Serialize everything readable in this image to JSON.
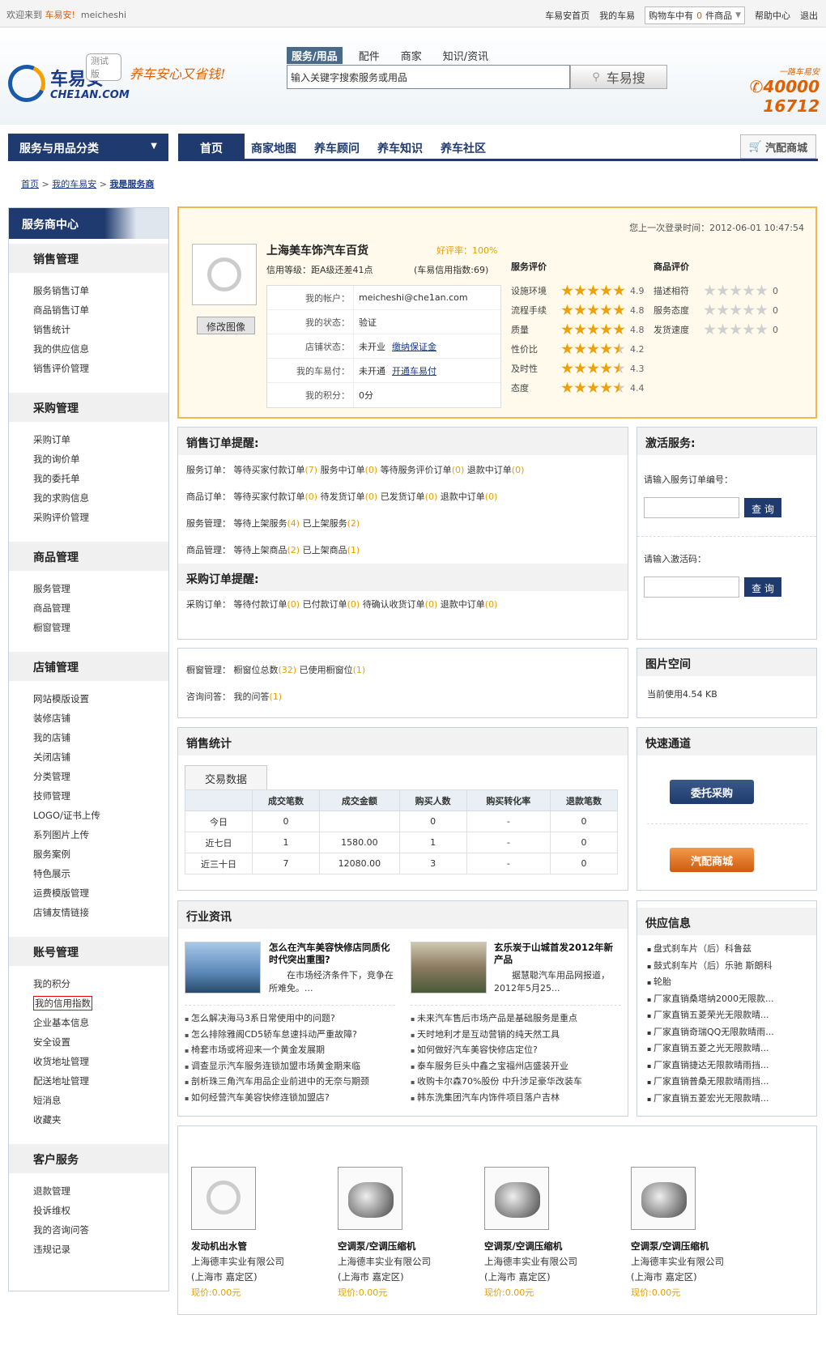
{
  "topbar": {
    "welcome": "欢迎来到",
    "site": "车易安!",
    "user": "meicheshi",
    "links": [
      "车易安首页",
      "我的车易"
    ],
    "cart_prefix": "购物车中有",
    "cart_count": "0",
    "cart_suffix": "件商品",
    "help": "帮助中心",
    "logout": "退出"
  },
  "header": {
    "logo_cn": "车易安",
    "logo_en": "CHE1AN.COM",
    "test_tag": "测试版",
    "slogan": "养车安心又省钱!",
    "search_tabs": [
      "服务/用品",
      "配件",
      "商家",
      "知识/资讯"
    ],
    "search_placeholder": "输入关键字搜索服务或用品",
    "search_button": "车易搜",
    "hotline_tag": "一路车易安",
    "hotline": "40000 16712"
  },
  "nav": {
    "category": "服务与用品分类",
    "items": [
      "首页",
      "商家地图",
      "养车顾问",
      "养车知识",
      "养车社区"
    ],
    "mall": "汽配商城"
  },
  "breadcrumb": [
    "首页",
    "我的车易安",
    "我是服务商"
  ],
  "sidebar": {
    "title": "服务商中心",
    "sections": [
      {
        "title": "销售管理",
        "items": [
          "服务销售订单",
          "商品销售订单",
          "销售统计",
          "我的供应信息",
          "销售评价管理"
        ]
      },
      {
        "title": "采购管理",
        "items": [
          "采购订单",
          "我的询价单",
          "我的委托单",
          "我的求购信息",
          "采购评价管理"
        ]
      },
      {
        "title": "商品管理",
        "items": [
          "服务管理",
          "商品管理",
          "橱窗管理"
        ]
      },
      {
        "title": "店铺管理",
        "items": [
          "网站模版设置",
          "装修店铺",
          "我的店铺",
          "关闭店铺",
          "分类管理",
          "技师管理",
          "LOGO/证书上传",
          "系列图片上传",
          "服务案例",
          "特色展示",
          "运费模版管理",
          "店铺友情链接"
        ]
      },
      {
        "title": "账号管理",
        "items": [
          "我的积分",
          "我的信用指数",
          "企业基本信息",
          "安全设置",
          "收货地址管理",
          "配送地址管理",
          "短消息",
          "收藏夹"
        ]
      },
      {
        "title": "客户服务",
        "items": [
          "退款管理",
          "投诉维权",
          "我的咨询问答",
          "违规记录"
        ]
      }
    ]
  },
  "profile": {
    "last_login": "您上一次登录时间：2012-06-01 10:47:54",
    "shop_name": "上海美车饰汽车百货",
    "good_rate": "好评率：100%",
    "credit_level": "信用等级：距A级还差41点",
    "credit_index": "(车易信用指数:69)",
    "change_pic": "修改图像",
    "info": [
      {
        "k": "我的帐户：",
        "v": "meicheshi@che1an.com",
        "link": ""
      },
      {
        "k": "我的状态：",
        "v": "验证",
        "link": ""
      },
      {
        "k": "店铺状态：",
        "v": "未开业",
        "link": "缴纳保证金"
      },
      {
        "k": "我的车易付：",
        "v": "未开通",
        "link": "开通车易付"
      },
      {
        "k": "我的积分：",
        "v": "0分",
        "link": ""
      }
    ],
    "service_title": "服务评价",
    "service_ratings": [
      {
        "k": "设施环境",
        "v": 4.9
      },
      {
        "k": "流程手续",
        "v": 4.8
      },
      {
        "k": "质量",
        "v": 4.8
      },
      {
        "k": "性价比",
        "v": 4.2
      },
      {
        "k": "及时性",
        "v": 4.3
      },
      {
        "k": "态度",
        "v": 4.4
      }
    ],
    "goods_title": "商品评价",
    "goods_ratings": [
      {
        "k": "描述相符",
        "v": 0
      },
      {
        "k": "服务态度",
        "v": 0
      },
      {
        "k": "发货速度",
        "v": 0
      }
    ]
  },
  "reminders": {
    "sales_title": "销售订单提醒:",
    "sales_lines": [
      [
        [
          "服务订单：  等待买家付款订单",
          "7"
        ],
        [
          "服务中订单",
          "0"
        ],
        [
          "等待服务评价订单",
          "0"
        ],
        [
          "退款中订单",
          "0"
        ]
      ],
      [
        [
          "商品订单：  等待买家付款订单",
          "0"
        ],
        [
          "待发货订单",
          "0"
        ],
        [
          "已发货订单",
          "0"
        ],
        [
          "退款中订单",
          "0"
        ]
      ],
      [
        [
          "服务管理：  等待上架服务",
          "4"
        ],
        [
          "已上架服务",
          "2"
        ]
      ],
      [
        [
          "商品管理：  等待上架商品",
          "2"
        ],
        [
          "已上架商品",
          "1"
        ]
      ]
    ],
    "purchase_title": "采购订单提醒:",
    "purchase_lines": [
      [
        [
          "采购订单：  等待付款订单",
          "0"
        ],
        [
          "已付款订单",
          "0"
        ],
        [
          "待确认收货订单",
          "0"
        ],
        [
          "退款中订单",
          "0"
        ]
      ]
    ]
  },
  "activate": {
    "title": "激活服务:",
    "label1": "请输入服务订单编号：",
    "label2": "请输入激活码：",
    "button": "查 询"
  },
  "window": {
    "lines": [
      [
        [
          "橱窗管理：  橱窗位总数",
          "32"
        ],
        [
          "已使用橱窗位",
          "1"
        ]
      ],
      [
        [
          "咨询问答：  我的问答",
          "1"
        ]
      ]
    ]
  },
  "photo": {
    "title": "图片空间",
    "usage": "当前使用4.54 KB"
  },
  "sales_stats": {
    "title": "销售统计",
    "tab": "交易数据",
    "headers": [
      "",
      "成交笔数",
      "成交金额",
      "购买人数",
      "购买转化率",
      "退款笔数"
    ],
    "rows": [
      [
        "今日",
        "0",
        "",
        "0",
        "-",
        "0"
      ],
      [
        "近七日",
        "1",
        "1580.00",
        "1",
        "-",
        "0"
      ],
      [
        "近三十日",
        "7",
        "12080.00",
        "3",
        "-",
        "0"
      ]
    ]
  },
  "quick": {
    "title": "快速通道",
    "btn1": "委托采购",
    "btn2": "汽配商城"
  },
  "news": {
    "title": "行业资讯",
    "featured": [
      {
        "title": "怎么在汽车美容快修店同质化时代突出重围?",
        "desc": "在市场经济条件下，竞争在所难免。..."
      },
      {
        "title": "玄乐炭于山城首发2012年新产品",
        "desc": "据慧聪汽车用品网报道，2012年5月25..."
      }
    ],
    "left_list": [
      "怎么解决海马3系日常使用中的问题?",
      "怎么排除雅阁CD5轿车怠速抖动严重故障?",
      "椅套市场或将迎来一个黄金发展期",
      "调查显示汽车服务连锁加盟市场黄金期来临",
      "剖析珠三角汽车用品企业前进中的无奈与期颈",
      "如何经营汽车美容快修连锁加盟店?"
    ],
    "right_list": [
      "未来汽车售后市场产品是基础服务是重点",
      "天时地利才是互动营销的纯天然工具",
      "如何做好汽车美容快修店定位?",
      "泰车服务巨头中鑫之宝福州店盛装开业",
      "收购卡尔森70%股份 中升涉足豪华改装车",
      "韩东洗集团汽车内饰件项目落户吉林"
    ]
  },
  "supply": {
    "title": "供应信息",
    "items": [
      "盘式刹车片（后）科鲁兹",
      "鼓式刹车片（后）乐驰 斯朗科",
      "轮胎",
      "厂家直销桑塔纳2000无限款...",
      "厂家直销五菱荣光无限款晴...",
      "厂家直销奇瑞QQ无限款晴雨...",
      "厂家直销五菱之光无限款晴...",
      "厂家直销捷达无限款晴雨挡...",
      "厂家直销普桑无限款晴雨挡...",
      "厂家直销五菱宏光无限款晴..."
    ]
  },
  "products": [
    {
      "name": "发动机出水管",
      "company": "上海德丰实业有限公司",
      "loc": "(上海市 嘉定区)",
      "price": "现价:0.00元",
      "img": "placeholder"
    },
    {
      "name": "空调泵/空调压缩机",
      "company": "上海德丰实业有限公司",
      "loc": "(上海市 嘉定区)",
      "price": "现价:0.00元",
      "img": "compressor"
    },
    {
      "name": "空调泵/空调压缩机",
      "company": "上海德丰实业有限公司",
      "loc": "(上海市 嘉定区)",
      "price": "现价:0.00元",
      "img": "compressor"
    },
    {
      "name": "空调泵/空调压缩机",
      "company": "上海德丰实业有限公司",
      "loc": "(上海市 嘉定区)",
      "price": "现价:0.00元",
      "img": "compressor"
    }
  ]
}
